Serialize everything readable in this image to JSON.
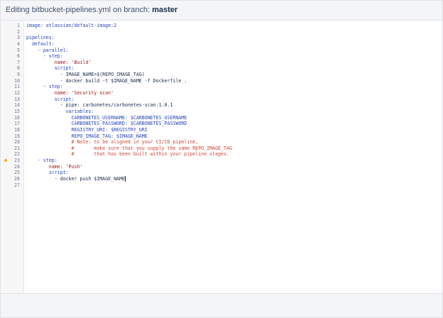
{
  "header": {
    "prefix": "Editing bitbucket-pipelines.yml on branch:",
    "branch": "master"
  },
  "code_lines": [
    {
      "num": "1",
      "text": "image: atlassian/default-image:2",
      "type": "k",
      "marker": false
    },
    {
      "num": "2",
      "text": "",
      "type": "p",
      "marker": false
    },
    {
      "num": "3",
      "text": "pipelines:",
      "type": "k",
      "marker": false
    },
    {
      "num": "4",
      "text": "  default:",
      "type": "k",
      "marker": false
    },
    {
      "num": "5",
      "text": "    - parallel:",
      "type": "k",
      "marker": false
    },
    {
      "num": "6",
      "text": "      - step:",
      "type": "k",
      "marker": false
    },
    {
      "num": "7",
      "text": "          name: 'Build'",
      "type": "s",
      "marker": false
    },
    {
      "num": "8",
      "text": "          script:",
      "type": "k",
      "marker": false
    },
    {
      "num": "9",
      "text": "            - IMAGE_NAME=$(REPO_IMAGE_TAG)",
      "type": "p",
      "marker": false
    },
    {
      "num": "10",
      "text": "            - docker build -t $IMAGE_NAME -f Dockerfile .",
      "type": "p",
      "marker": false
    },
    {
      "num": "11",
      "text": "      - step:",
      "type": "k",
      "marker": false
    },
    {
      "num": "12",
      "text": "          name: 'Security scan'",
      "type": "s",
      "marker": false
    },
    {
      "num": "13",
      "text": "          script:",
      "type": "k",
      "marker": false
    },
    {
      "num": "14",
      "text": "            - pipe: carbonetes/carbonetes-scan:1.0.1",
      "type": "p",
      "marker": false
    },
    {
      "num": "15",
      "text": "              variables:",
      "type": "k",
      "marker": false
    },
    {
      "num": "16",
      "text": "                CARBONETES_USERNAME: $CARBONETES_USERNAME",
      "type": "k",
      "marker": false
    },
    {
      "num": "17",
      "text": "                CARBONETES_PASSWORD: $CARBONETES_PASSWORD",
      "type": "k",
      "marker": false
    },
    {
      "num": "18",
      "text": "                REGISTRY_URI: $REGISTRY_URI",
      "type": "k",
      "marker": false
    },
    {
      "num": "19",
      "text": "                REPO_IMAGE_TAG: $IMAGE_NAME",
      "type": "k",
      "marker": false
    },
    {
      "num": "20",
      "text": "                # Note: to be aligned in your CI/CD pipeline,",
      "type": "c",
      "marker": false
    },
    {
      "num": "21",
      "text": "                #       make sure that you supply the same REPO_IMAGE_TAG",
      "type": "c",
      "marker": false
    },
    {
      "num": "22",
      "text": "                #       that has been built within your pipeline stages.",
      "type": "c",
      "marker": false
    },
    {
      "num": "23",
      "text": "    - step:",
      "type": "k",
      "marker": true
    },
    {
      "num": "24",
      "text": "        name: 'Push'",
      "type": "s",
      "marker": false
    },
    {
      "num": "25",
      "text": "        script:",
      "type": "k",
      "marker": false
    },
    {
      "num": "26",
      "text": "          - docker push $IMAGE_NAME",
      "type": "p",
      "marker": false,
      "caret": true
    },
    {
      "num": "27",
      "text": "",
      "type": "p",
      "marker": false
    }
  ],
  "colors": {
    "keyword": "#2646b8",
    "string": "#a31515",
    "comment": "#d04437",
    "marker": "#ffab00"
  }
}
